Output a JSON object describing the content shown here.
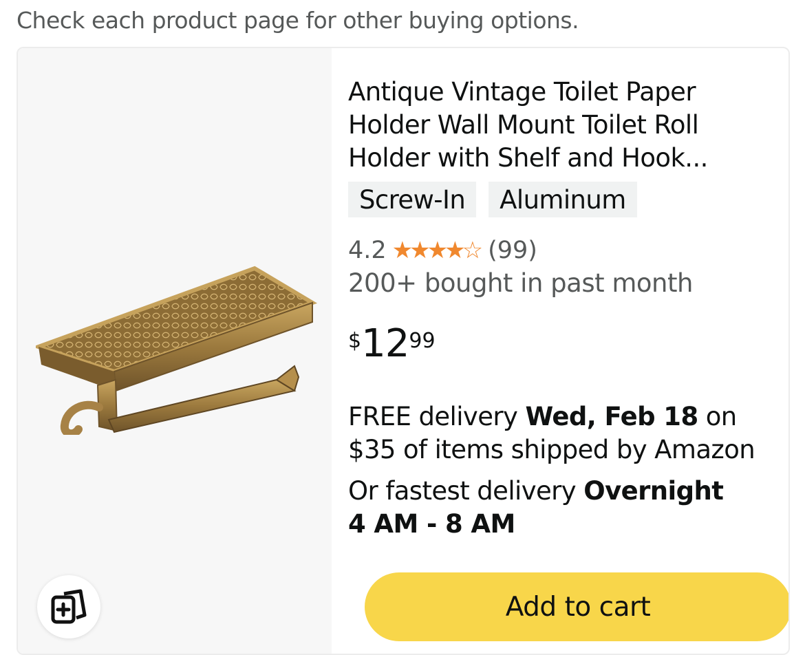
{
  "notice": "Check each product page for other buying options.",
  "product": {
    "title": "Antique Vintage Toilet Paper Holder Wall Mount Toilet Roll Holder with Shelf and Hook...",
    "chips": [
      "Screw-In",
      "Aluminum"
    ],
    "rating": "4.2",
    "rating_value": 4.2,
    "rating_max": 5,
    "review_count": "(99)",
    "bought": "200+ bought in past month",
    "price": {
      "symbol": "$",
      "whole": "12",
      "fraction": "99"
    },
    "delivery": {
      "prefix": "FREE delivery ",
      "date": "Wed, Feb 18",
      "suffix": " on $35 of items shipped by Amazon"
    },
    "fastest": {
      "prefix": "Or fastest delivery ",
      "speed": "Overnight",
      "window": "4 AM - 8 AM"
    },
    "add_to_cart": "Add to cart"
  },
  "colors": {
    "star": "#f0882e",
    "button": "#f8d64a",
    "chip_bg": "#f0f2f2",
    "muted_text": "#565959",
    "image_bg": "#f7f7f7"
  },
  "icons": {
    "compare": "compare-add-icon",
    "stars": "star-rating-icon"
  }
}
